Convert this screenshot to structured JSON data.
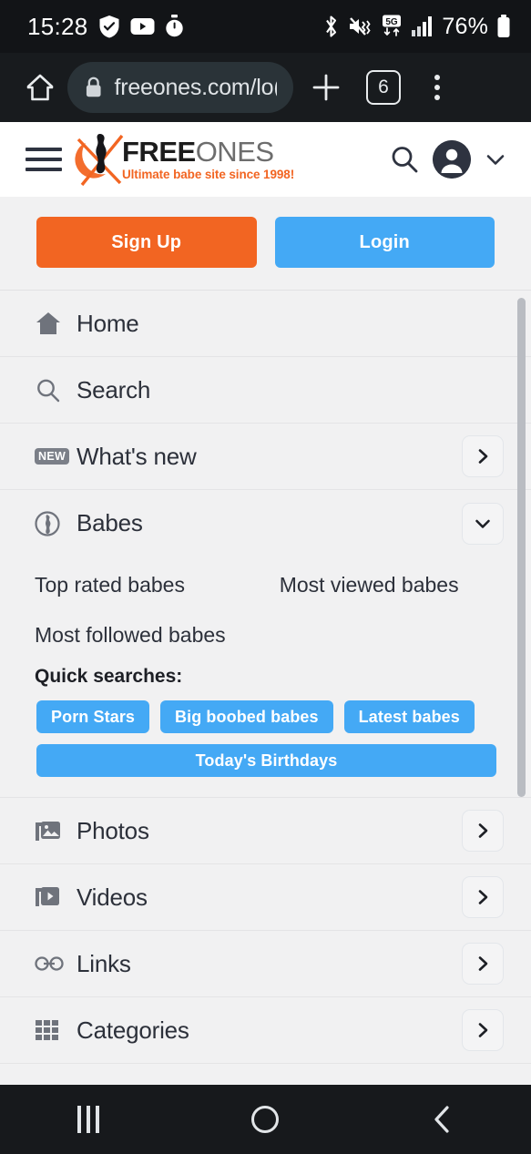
{
  "status_bar": {
    "time": "15:28",
    "left_icons": [
      "shield-check-icon",
      "youtube-icon",
      "stopwatch-icon"
    ],
    "right_icons": [
      "bluetooth-icon",
      "mute-vibrate-icon",
      "5g-data-icon",
      "signal-bars-icon"
    ],
    "network_label": "5G",
    "battery_percent": "76%"
  },
  "browser": {
    "home_icon": "home-icon",
    "lock_icon": "lock-icon",
    "url": "freeones.com/lo(",
    "new_tab_icon": "plus-icon",
    "tab_count": "6",
    "more_icon": "overflow-menu-icon"
  },
  "site_header": {
    "menu_icon": "hamburger-icon",
    "logo_primary": "FREE",
    "logo_secondary": "ONES",
    "logo_tagline": "Ultimate babe site since 1998!",
    "search_icon": "search-icon",
    "avatar_icon": "avatar-icon",
    "account_chevron_icon": "chevron-down-icon"
  },
  "auth": {
    "signup_label": "Sign Up",
    "login_label": "Login",
    "signup_color": "#f26522",
    "login_color": "#44a9f5"
  },
  "menu": {
    "items": [
      {
        "label": "Home",
        "icon": "home-icon",
        "has_chevron": false
      },
      {
        "label": "Search",
        "icon": "search-icon",
        "has_chevron": false
      },
      {
        "label": "What's new",
        "icon": "new-badge-icon",
        "badge": "NEW",
        "has_chevron": true,
        "chevron": "chevron-right-icon"
      },
      {
        "label": "Babes",
        "icon": "babe-silhouette-icon",
        "has_chevron": true,
        "chevron": "chevron-down-icon",
        "expanded": true
      },
      {
        "label": "Photos",
        "icon": "photos-icon",
        "has_chevron": true,
        "chevron": "chevron-right-icon"
      },
      {
        "label": "Videos",
        "icon": "videos-icon",
        "has_chevron": true,
        "chevron": "chevron-right-icon"
      },
      {
        "label": "Links",
        "icon": "link-icon",
        "has_chevron": true,
        "chevron": "chevron-right-icon"
      },
      {
        "label": "Categories",
        "icon": "grid-icon",
        "has_chevron": true,
        "chevron": "chevron-right-icon"
      }
    ]
  },
  "babes_panel": {
    "sublinks": [
      "Top rated babes",
      "Most viewed babes",
      "Most followed babes"
    ],
    "quick_searches_title": "Quick searches:",
    "tags": [
      "Porn Stars",
      "Big boobed babes",
      "Latest babes",
      "Today's Birthdays"
    ]
  },
  "android_nav": {
    "recents_label": "recents-icon",
    "home_label": "home-icon",
    "back_label": "back-icon"
  }
}
